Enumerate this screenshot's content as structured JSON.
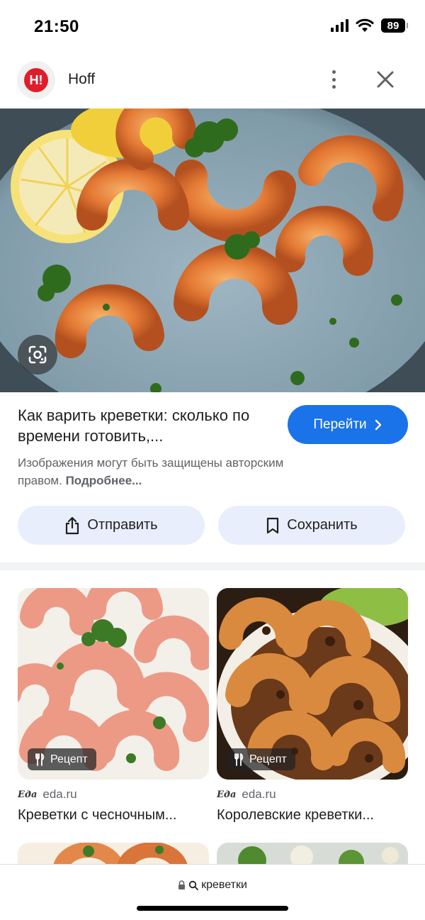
{
  "status_bar": {
    "time": "21:50",
    "battery": "89"
  },
  "source": {
    "logo_text": "H!",
    "name": "Hoff"
  },
  "result": {
    "title": "Как варить креветки: сколько по времени готовить,...",
    "go_label": "Перейти",
    "copyright_text": "Изображения могут быть защищены авторским правом.",
    "more_link": "Подробнее...",
    "share_label": "Отправить",
    "save_label": "Сохранить"
  },
  "related": [
    {
      "badge": "Рецепт",
      "source_mark": "Еда",
      "source": "eda.ru",
      "title": "Креветки с чесночным..."
    },
    {
      "badge": "Рецепт",
      "source_mark": "Еда",
      "source": "eda.ru",
      "title": "Королевские креветки..."
    }
  ],
  "bottom_bar": {
    "query": "креветки"
  },
  "icons": {
    "more": "more-vert-icon",
    "close": "close-icon",
    "lens": "lens-icon",
    "chevron": "chevron-right-icon",
    "share": "share-icon",
    "bookmark": "bookmark-icon",
    "recipe": "fork-knife-icon",
    "lock": "lock-icon",
    "search": "search-icon"
  },
  "colors": {
    "accent": "#1a73e8",
    "chip_bg": "#e8eefb",
    "brand": "#e11d2a"
  }
}
